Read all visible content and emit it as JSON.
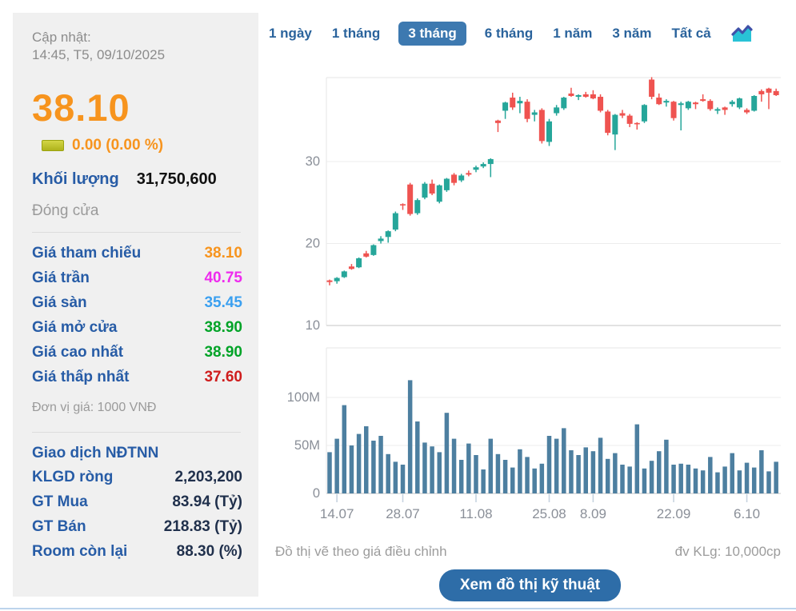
{
  "sidebar": {
    "updated_label": "Cập nhật:",
    "updated_value": "14:45, T5, 09/10/2025",
    "price": "38.10",
    "change": "0.00 (0.00 %)",
    "volume_label": "Khối lượng",
    "volume_value": "31,750,600",
    "session_status": "Đóng cửa",
    "price_rows": [
      {
        "label": "Giá tham chiếu",
        "value": "38.10",
        "color": "#f7941e"
      },
      {
        "label": "Giá trần",
        "value": "40.75",
        "color": "#ee2bee"
      },
      {
        "label": "Giá sàn",
        "value": "35.45",
        "color": "#3ba0f0"
      },
      {
        "label": "Giá mở cửa",
        "value": "38.90",
        "color": "#00a327"
      },
      {
        "label": "Giá cao nhất",
        "value": "38.90",
        "color": "#00a327"
      },
      {
        "label": "Giá thấp nhất",
        "value": "37.60",
        "color": "#cf1d1d"
      }
    ],
    "unit_note": "Đơn vị giá: 1000 VNĐ",
    "foreign_title": "Giao dịch NĐTNN",
    "foreign_rows": [
      {
        "label": "KLGD ròng",
        "value": "2,203,200"
      },
      {
        "label": "GT Mua",
        "value": "83.94 (Tỷ)"
      },
      {
        "label": "GT Bán",
        "value": "218.83 (Tỷ)"
      },
      {
        "label": "Room còn lại",
        "value": "88.30 (%)"
      }
    ]
  },
  "tabs": {
    "items": [
      "1 ngày",
      "1 tháng",
      "3 tháng",
      "6 tháng",
      "1 năm",
      "3 năm",
      "Tất cả"
    ],
    "active": "3 tháng"
  },
  "footer": {
    "note_left": "Đồ thị vẽ theo giá điều chỉnh",
    "note_right": "đv KLg: 10,000cp",
    "button": "Xem đồ thị kỹ thuật"
  },
  "chart_data": {
    "type": "candlestick+volume",
    "title": "",
    "price_axis": {
      "ticks": [
        10,
        20,
        30
      ],
      "range": [
        10,
        40.2
      ],
      "unit": "1000 VND"
    },
    "volume_axis": {
      "tick_values": [
        0,
        50,
        100
      ],
      "tick_labels": [
        "0",
        "50M",
        "100M"
      ],
      "unit": "shares (dv KLg: 10,000cp)"
    },
    "x_ticks": [
      {
        "label": "14.07",
        "day": 1
      },
      {
        "label": "28.07",
        "day": 10
      },
      {
        "label": "11.08",
        "day": 20
      },
      {
        "label": "25.08",
        "day": 30
      },
      {
        "label": "8.09",
        "day": 36
      },
      {
        "label": "22.09",
        "day": 47
      },
      {
        "label": "6.10",
        "day": 57
      }
    ],
    "colors": {
      "up": "#26a69a",
      "down": "#ef5350",
      "volume_bar": "#4d7fa0",
      "grid": "#ececec",
      "axis": "#d8d8d8",
      "border": "#e6e6e6",
      "tick": "#c7d3df",
      "label": "#8a8f98"
    },
    "candles_ohlc": [
      [
        15.5,
        15.6,
        14.9,
        15.3
      ],
      [
        15.4,
        15.9,
        15.1,
        15.8
      ],
      [
        15.9,
        16.7,
        15.8,
        16.6
      ],
      [
        17.2,
        17.5,
        16.8,
        16.9
      ],
      [
        17.1,
        18.3,
        17.0,
        18.2
      ],
      [
        18.8,
        19.1,
        18.3,
        18.4
      ],
      [
        18.6,
        19.9,
        18.5,
        19.8
      ],
      [
        20.3,
        20.9,
        20.0,
        20.6
      ],
      [
        20.8,
        21.6,
        20.1,
        21.5
      ],
      [
        21.7,
        23.9,
        21.5,
        23.7
      ],
      [
        24.8,
        24.9,
        24.1,
        24.7
      ],
      [
        27.2,
        27.4,
        23.4,
        23.6
      ],
      [
        23.7,
        25.5,
        23.5,
        25.3
      ],
      [
        25.6,
        27.5,
        25.4,
        27.3
      ],
      [
        27.3,
        27.8,
        25.9,
        26.1
      ],
      [
        25.1,
        27.2,
        24.9,
        27.1
      ],
      [
        26.5,
        28.0,
        26.3,
        27.9
      ],
      [
        28.4,
        28.6,
        27.1,
        27.4
      ],
      [
        27.7,
        28.5,
        27.5,
        28.3
      ],
      [
        28.6,
        28.9,
        28.2,
        28.4
      ],
      [
        29.0,
        29.5,
        28.7,
        29.3
      ],
      [
        29.4,
        29.9,
        29.2,
        29.7
      ],
      [
        29.7,
        30.4,
        28.1,
        30.3
      ],
      [
        35.0,
        35.1,
        33.6,
        34.7
      ],
      [
        36.2,
        37.3,
        35.2,
        37.2
      ],
      [
        37.8,
        38.4,
        36.3,
        36.6
      ],
      [
        37.1,
        37.9,
        35.9,
        37.4
      ],
      [
        37.3,
        37.6,
        34.8,
        35.2
      ],
      [
        35.7,
        36.3,
        34.9,
        36.0
      ],
      [
        36.3,
        36.5,
        32.2,
        32.5
      ],
      [
        32.4,
        35.2,
        31.9,
        34.9
      ],
      [
        35.9,
        36.9,
        35.6,
        36.6
      ],
      [
        36.5,
        37.9,
        36.3,
        37.8
      ],
      [
        38.3,
        39.0,
        37.9,
        38.0
      ],
      [
        37.9,
        38.2,
        37.5,
        38.1
      ],
      [
        38.2,
        38.5,
        37.8,
        37.9
      ],
      [
        38.2,
        38.7,
        37.6,
        37.7
      ],
      [
        37.9,
        38.2,
        36.0,
        36.2
      ],
      [
        36.1,
        36.3,
        33.2,
        33.5
      ],
      [
        33.3,
        35.8,
        31.4,
        35.7
      ],
      [
        35.9,
        36.3,
        35.3,
        35.6
      ],
      [
        35.6,
        35.8,
        34.2,
        34.6
      ],
      [
        34.7,
        34.8,
        33.9,
        34.6
      ],
      [
        34.9,
        37.0,
        34.7,
        36.9
      ],
      [
        40.0,
        40.3,
        37.6,
        37.9
      ],
      [
        37.8,
        38.3,
        36.9,
        37.0
      ],
      [
        37.2,
        37.6,
        36.7,
        37.4
      ],
      [
        37.3,
        37.4,
        35.0,
        35.3
      ],
      [
        36.9,
        37.3,
        33.8,
        37.1
      ],
      [
        36.5,
        37.4,
        36.3,
        37.3
      ],
      [
        37.2,
        37.3,
        36.4,
        37.0
      ],
      [
        37.6,
        38.2,
        37.3,
        37.4
      ],
      [
        37.4,
        37.6,
        36.2,
        36.4
      ],
      [
        36.2,
        36.6,
        35.8,
        36.4
      ],
      [
        36.6,
        36.7,
        35.7,
        36.3
      ],
      [
        37.0,
        37.5,
        36.7,
        37.3
      ],
      [
        36.6,
        37.8,
        36.4,
        37.7
      ],
      [
        36.3,
        36.5,
        35.8,
        36.0
      ],
      [
        36.2,
        38.1,
        36.1,
        38.0
      ],
      [
        38.6,
        38.8,
        37.3,
        38.2
      ],
      [
        38.9,
        39.0,
        36.4,
        38.4
      ],
      [
        38.6,
        38.9,
        38.0,
        38.1
      ]
    ],
    "volumes_M": [
      43,
      57,
      92,
      50,
      62,
      70,
      55,
      60,
      41,
      33,
      30,
      118,
      75,
      53,
      49,
      43,
      84,
      57,
      35,
      52,
      40,
      25,
      57,
      41,
      35,
      27,
      46,
      38,
      26,
      31,
      60,
      57,
      68,
      45,
      40,
      48,
      44,
      58,
      36,
      42,
      30,
      28,
      72,
      26,
      34,
      44,
      56,
      30,
      31,
      30,
      26,
      24,
      38,
      22,
      28,
      42,
      24,
      32,
      27,
      45,
      23,
      33
    ]
  }
}
